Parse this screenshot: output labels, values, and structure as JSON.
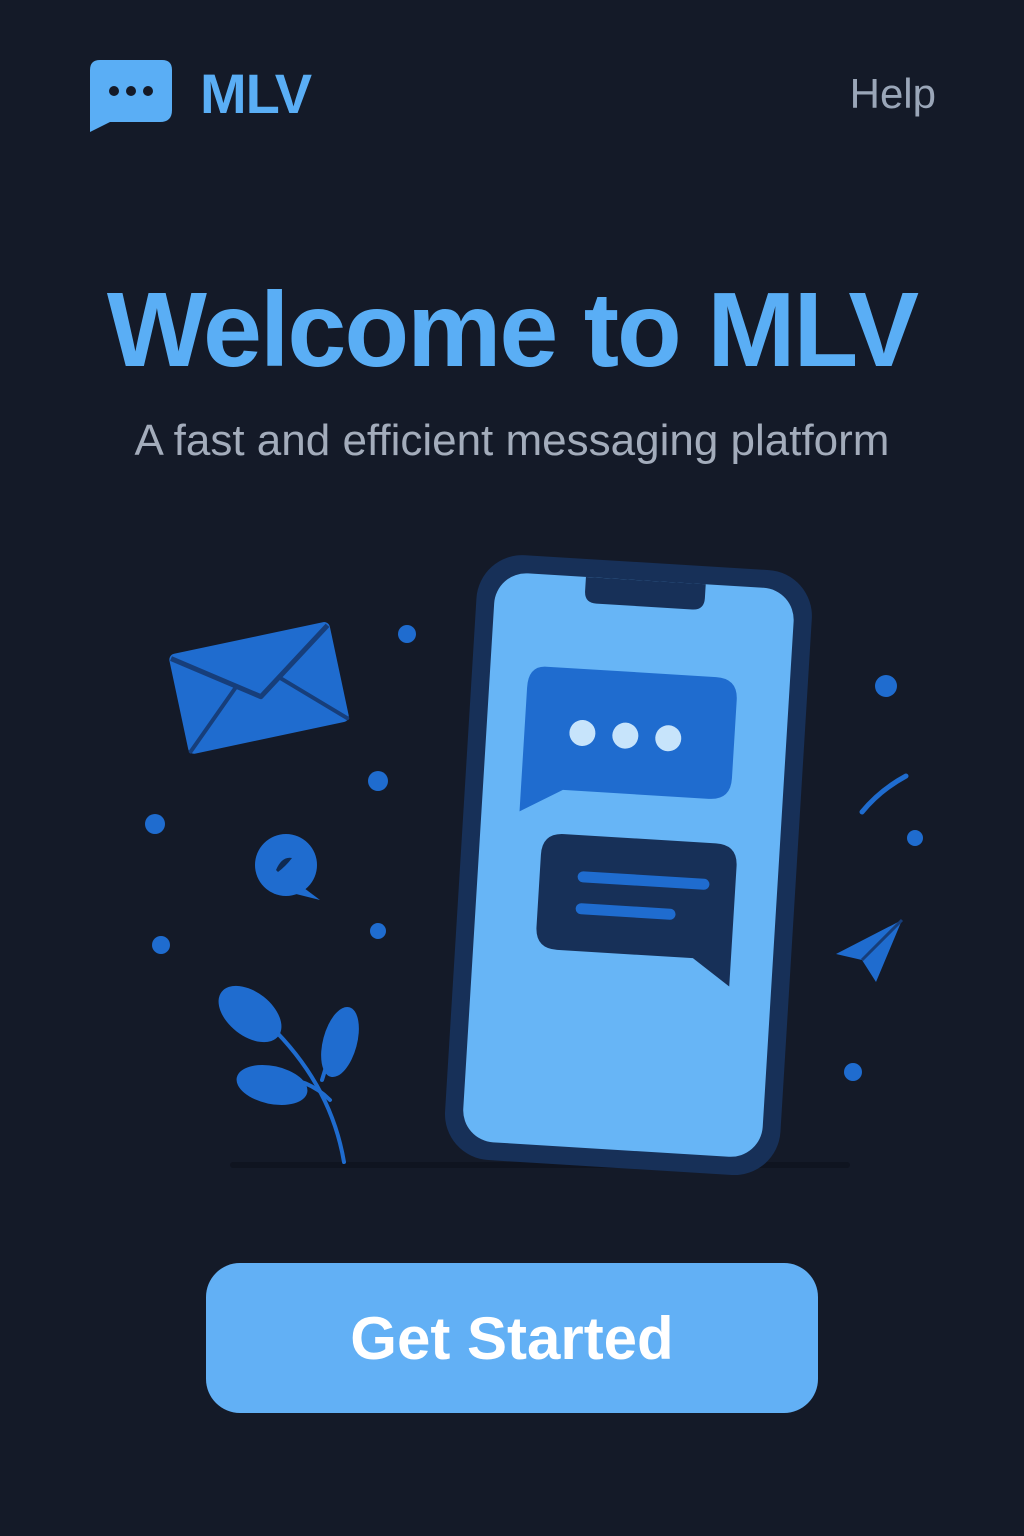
{
  "header": {
    "brand_name": "MLV",
    "brand_icon": "chat-bubble-dots-icon",
    "help_label": "Help"
  },
  "hero": {
    "title": "Welcome to MLV",
    "subtitle": "A fast and efficient messaging platform"
  },
  "illustration": {
    "icons": [
      "envelope-icon",
      "phone-icon",
      "chat-bubble-dots-icon",
      "chat-bubble-lines-icon",
      "speech-bubble-icon",
      "paper-plane-icon",
      "leaf-icon"
    ]
  },
  "cta": {
    "label": "Get Started"
  },
  "colors": {
    "background": "#141a28",
    "accent": "#5aaef5",
    "deep_blue": "#1f6ccf",
    "navy": "#173058",
    "muted_text": "#a3acbb"
  }
}
